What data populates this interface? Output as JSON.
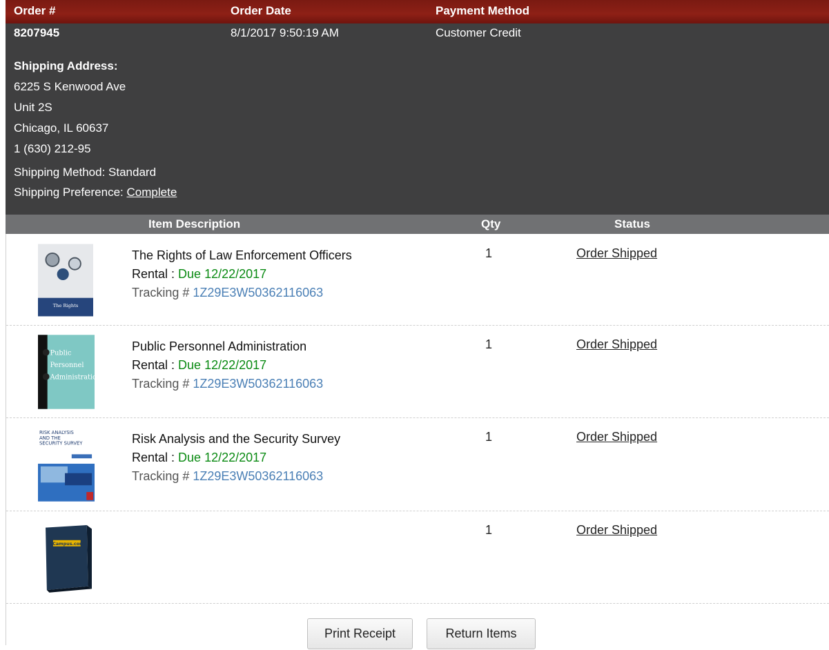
{
  "header": {
    "order_label": "Order #",
    "date_label": "Order Date",
    "payment_label": "Payment Method"
  },
  "order": {
    "number": "8207945",
    "date": "8/1/2017 9:50:19 AM",
    "payment": "Customer Credit",
    "shipping_address_label": "Shipping Address:",
    "address_line1": "6225 S Kenwood Ave",
    "address_line2": "Unit 2S",
    "address_line3": "Chicago, IL 60637",
    "phone": "1 (630) 212-95",
    "shipping_method": "Shipping Method: Standard",
    "shipping_pref_label": "Shipping Preference:",
    "shipping_pref_value": "Complete"
  },
  "items_header": {
    "description": "Item Description",
    "qty": "Qty",
    "status": "Status"
  },
  "items": [
    {
      "title": "The Rights of Law Enforcement Officers",
      "rental_label": "Rental : ",
      "due": "Due 12/22/2017",
      "tracking_label": "Tracking # ",
      "tracking": "1Z29E3W50362116063",
      "qty": "1",
      "status": "Order Shipped"
    },
    {
      "title": "Public Personnel Administration",
      "rental_label": "Rental : ",
      "due": "Due 12/22/2017",
      "tracking_label": "Tracking # ",
      "tracking": "1Z29E3W50362116063",
      "qty": "1",
      "status": "Order Shipped"
    },
    {
      "title": "Risk Analysis and the Security Survey",
      "rental_label": "Rental : ",
      "due": "Due 12/22/2017",
      "tracking_label": "Tracking # ",
      "tracking": "1Z29E3W50362116063",
      "qty": "1",
      "status": "Order Shipped"
    },
    {
      "title": "",
      "qty": "1",
      "status": "Order Shipped"
    }
  ],
  "covers": {
    "book1_text": "The Rights",
    "book2_lines": [
      "Public",
      "Personnel",
      "Administration"
    ],
    "book3_lines": [
      "RISK ANALYSIS",
      "AND THE",
      "SECURITY SURVEY"
    ],
    "book4_text": "eCampus.com"
  },
  "buttons": {
    "print": "Print Receipt",
    "return": "Return Items"
  },
  "colors": {
    "header_red": "#8e2016",
    "panel_gray": "#3f3f40",
    "due_green": "#0a8a12",
    "tracking_blue": "#4a7fb5"
  }
}
